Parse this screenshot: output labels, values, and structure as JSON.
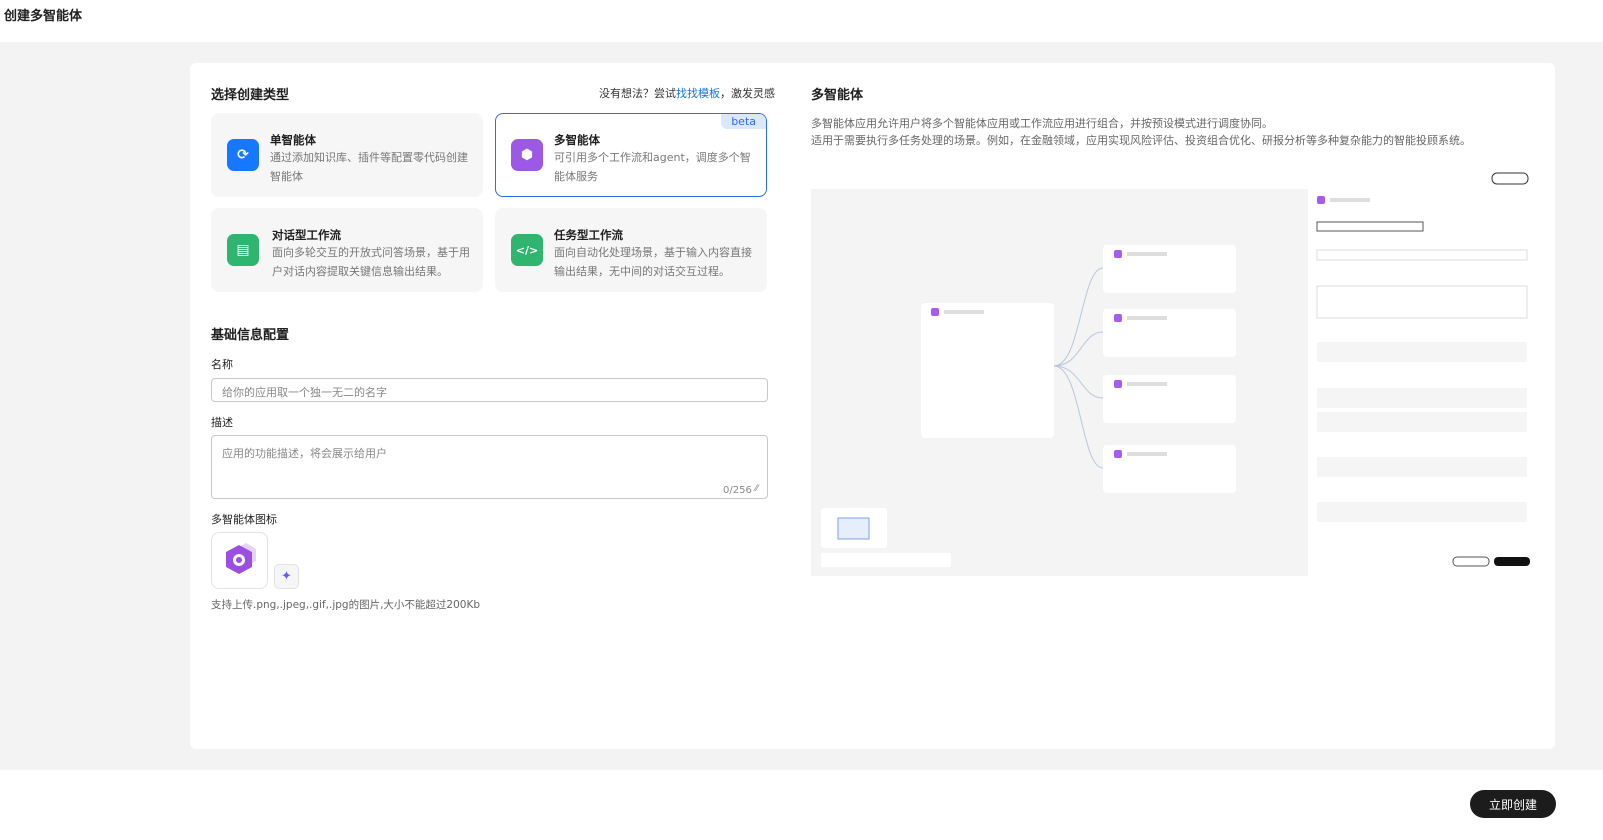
{
  "header": {
    "title": "创建多智能体"
  },
  "left": {
    "section_title": "选择创建类型",
    "hint_prefix": "没有想法？尝试",
    "hint_link": "找找模板",
    "hint_suffix": "，激发灵感",
    "types": [
      {
        "name": "单智能体",
        "desc": "通过添加知识库、插件等配置零代码创建智能体",
        "icon": "single-agent-icon",
        "color": "#1677ff",
        "selected": false
      },
      {
        "name": "多智能体",
        "desc": "可引用多个工作流和agent，调度多个智能体服务",
        "icon": "multi-agent-icon",
        "color": "#9b59e6",
        "selected": true,
        "badge": "beta"
      },
      {
        "name": "对话型工作流",
        "desc": "面向多轮交互的开放式问答场景，基于用户对话内容提取关键信息输出结果。",
        "icon": "chat-workflow-icon",
        "color": "#2fb56f",
        "selected": false
      },
      {
        "name": "任务型工作流",
        "desc": "面向自动化处理场景，基于输入内容直接输出结果，无中间的对话交互过程。",
        "icon": "code-workflow-icon",
        "color": "#2fb56f",
        "selected": false
      }
    ],
    "basic_title": "基础信息配置",
    "name_label": "名称",
    "name_placeholder": "给你的应用取一个独一无二的名字",
    "desc_label": "描述",
    "desc_placeholder": "应用的功能描述，将会展示给用户",
    "desc_counter": "0/256",
    "icon_label": "多智能体图标",
    "icon_hint": "支持上传.png,.jpeg,.gif,.jpg的图片,大小不能超过200Kb"
  },
  "right": {
    "title": "多智能体",
    "desc_line1": "多智能体应用允许用户将多个智能体应用或工作流应用进行组合，并按预设模式进行调度协同。",
    "desc_line2": "适用于需要执行多任务处理的场景。例如，在金融领域，应用实现风险评估、投资组合优化、研报分析等多种复杂能力的智能投顾系统。"
  },
  "footer": {
    "create_button": "立即创建"
  },
  "colors": {
    "accent": "#2a6fe6",
    "primary_button": "#1c1c1c"
  }
}
